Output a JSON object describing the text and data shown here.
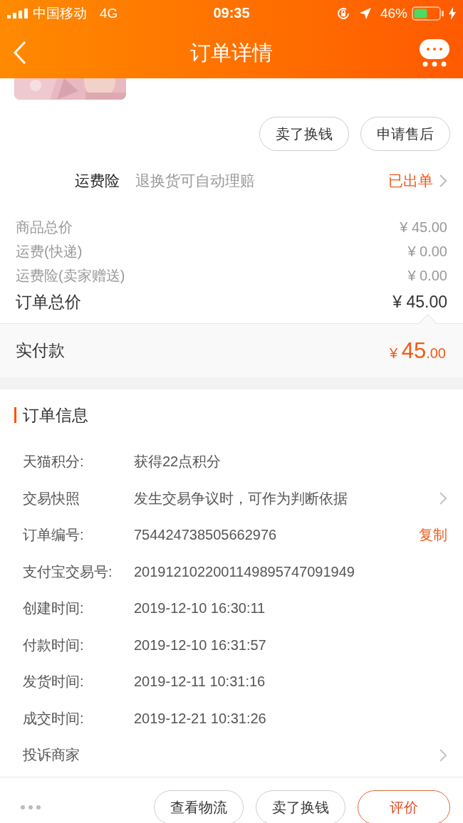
{
  "status_bar": {
    "carrier": "中国移动",
    "network": "4G",
    "time": "09:35",
    "battery": "46%"
  },
  "nav": {
    "title": "订单详情"
  },
  "actions": [
    {
      "label": "卖了换钱",
      "primary": false
    },
    {
      "label": "申请售后",
      "primary": false
    }
  ],
  "insurance": {
    "label": "运费险",
    "description": "退换货可自动理赔",
    "status": "已出单"
  },
  "prices": [
    {
      "label": "商品总价",
      "value": "¥ 45.00",
      "kind": "minor"
    },
    {
      "label": "运费(快递)",
      "value": "¥ 0.00",
      "kind": "minor"
    },
    {
      "label": "运费险(卖家赠送)",
      "value": "¥ 0.00",
      "kind": "minor"
    },
    {
      "label": "订单总价",
      "value": "¥ 45.00",
      "kind": "total"
    }
  ],
  "paid": {
    "label": "实付款",
    "amount": "¥ 45.00"
  },
  "order_info": {
    "title": "订单信息",
    "rows": [
      {
        "label": "天猫积分:",
        "value": "获得22点积分",
        "chevron": false
      },
      {
        "label": "交易快照",
        "value": "发生交易争议时，可作为判断依据",
        "chevron": true
      },
      {
        "label": "订单编号:",
        "value": "754424738505662976",
        "action": "复制",
        "chevron": false
      },
      {
        "label": "支付宝交易号:",
        "value": "2019121022001149895747091949",
        "chevron": false
      },
      {
        "label": "创建时间:",
        "value": "2019-12-10 16:30:11",
        "chevron": false
      },
      {
        "label": "付款时间:",
        "value": "2019-12-10 16:31:57",
        "chevron": false
      },
      {
        "label": "发货时间:",
        "value": "2019-12-11 10:31:16",
        "chevron": false
      },
      {
        "label": "成交时间:",
        "value": "2019-12-21 10:31:26",
        "chevron": false
      },
      {
        "label": "投诉商家",
        "chevron": true
      }
    ]
  },
  "bottom_bar": {
    "buttons": [
      {
        "label": "查看物流",
        "primary": false
      },
      {
        "label": "卖了换钱",
        "primary": false
      },
      {
        "label": "评价",
        "primary": true
      }
    ]
  }
}
